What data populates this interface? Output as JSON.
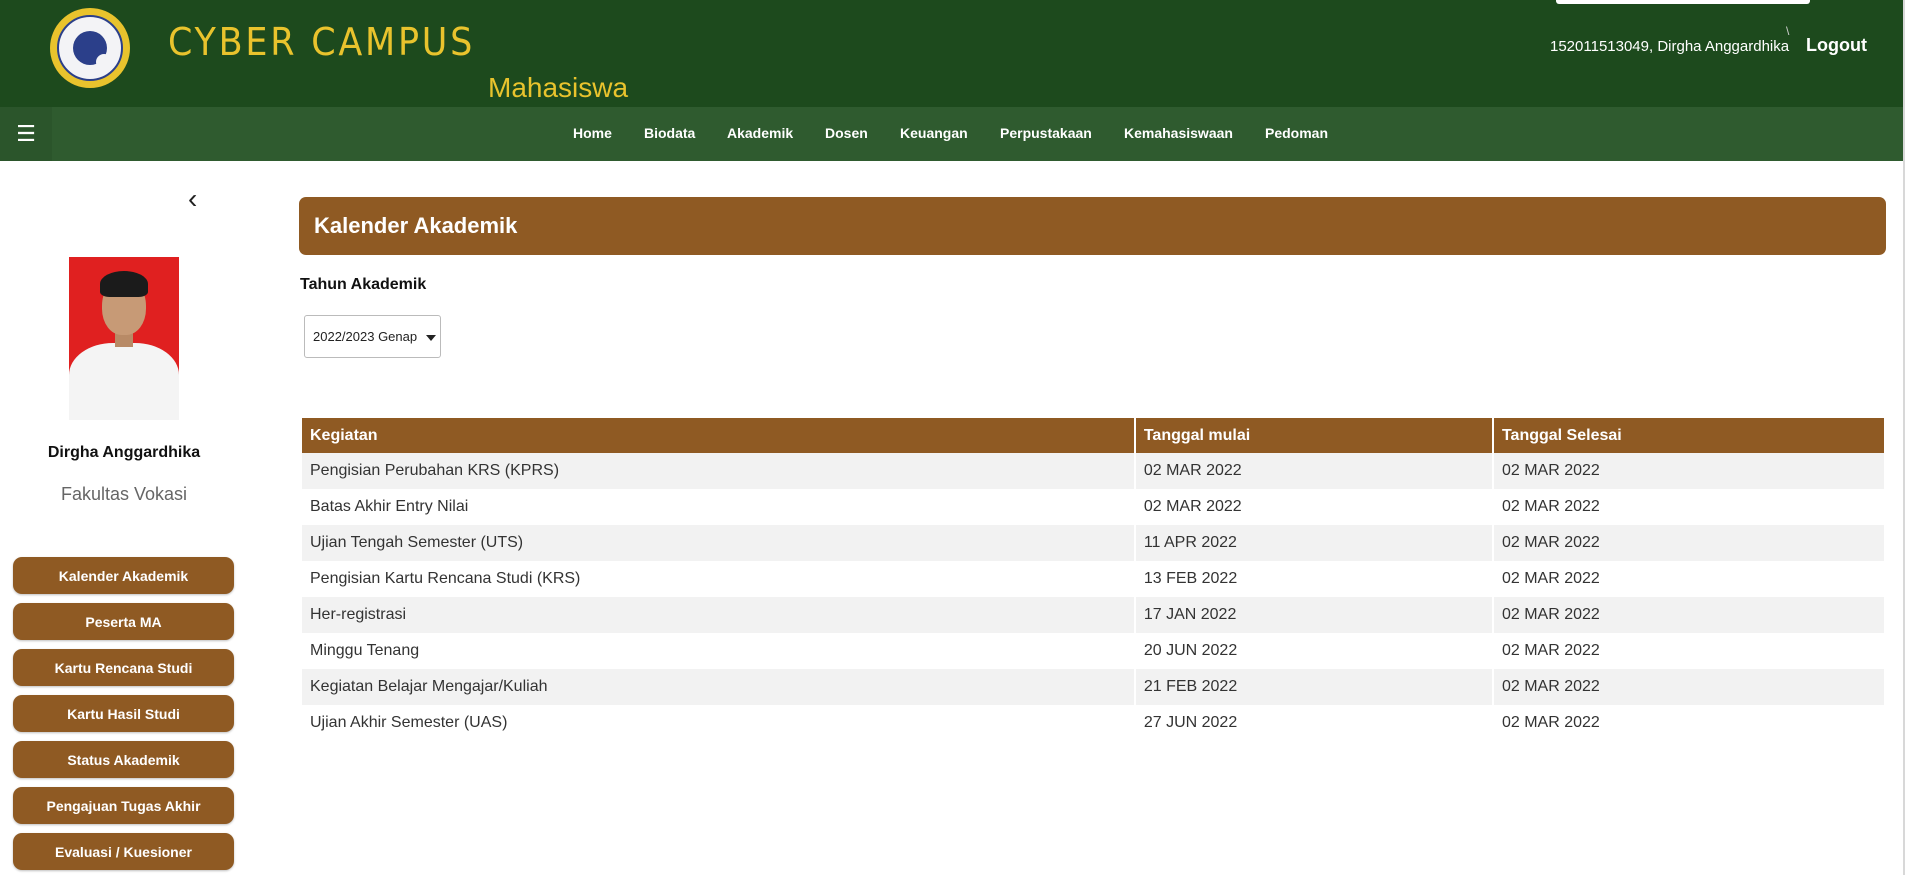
{
  "header": {
    "brand": "CYBER CAMPUS",
    "sub_brand": "Mahasiswa",
    "user_id": "152011513049, Dirgha Anggardhika",
    "logout_label": "Logout",
    "separator": "\\"
  },
  "nav": {
    "toggle_icon": "☰",
    "items": [
      {
        "label": "Home"
      },
      {
        "label": "Biodata"
      },
      {
        "label": "Akademik"
      },
      {
        "label": "Dosen"
      },
      {
        "label": "Keuangan"
      },
      {
        "label": "Perpustakaan"
      },
      {
        "label": "Kemahasiswaan"
      },
      {
        "label": "Pedoman"
      }
    ]
  },
  "sidebar": {
    "collapse_icon": "‹",
    "student_name": "Dirgha Anggardhika",
    "faculty": "Fakultas Vokasi",
    "buttons": [
      {
        "label": "Kalender Akademik"
      },
      {
        "label": "Peserta MA"
      },
      {
        "label": "Kartu Rencana Studi"
      },
      {
        "label": "Kartu Hasil Studi"
      },
      {
        "label": "Status Akademik"
      },
      {
        "label": "Pengajuan Tugas Akhir"
      },
      {
        "label": "Evaluasi / Kuesioner"
      }
    ]
  },
  "main": {
    "title": "Kalender Akademik",
    "year_label": "Tahun Akademik",
    "year_select": {
      "selected": "2022/2023 Genap"
    },
    "table": {
      "headers": [
        "Kegiatan",
        "Tanggal mulai",
        "Tanggal Selesai"
      ],
      "rows": [
        [
          "Pengisian Perubahan KRS (KPRS)",
          "02 MAR 2022",
          "02 MAR 2022"
        ],
        [
          "Batas Akhir Entry Nilai",
          "02 MAR 2022",
          "02 MAR 2022"
        ],
        [
          "Ujian Tengah Semester (UTS)",
          "11 APR 2022",
          "02 MAR 2022"
        ],
        [
          "Pengisian Kartu Rencana Studi (KRS)",
          "13 FEB 2022",
          "02 MAR 2022"
        ],
        [
          "Her-registrasi",
          "17 JAN 2022",
          "02 MAR 2022"
        ],
        [
          "Minggu Tenang",
          "20 JUN 2022",
          "02 MAR 2022"
        ],
        [
          "Kegiatan Belajar Mengajar/Kuliah",
          "21 FEB 2022",
          "02 MAR 2022"
        ],
        [
          "Ujian Akhir Semester (UAS)",
          "27 JUN 2022",
          "02 MAR 2022"
        ]
      ]
    }
  },
  "colors": {
    "header_green": "#1d4a1d",
    "nav_green": "#2f5b2f",
    "brand_gold": "#e9c32d",
    "accent_brown": "#8f5a23"
  }
}
